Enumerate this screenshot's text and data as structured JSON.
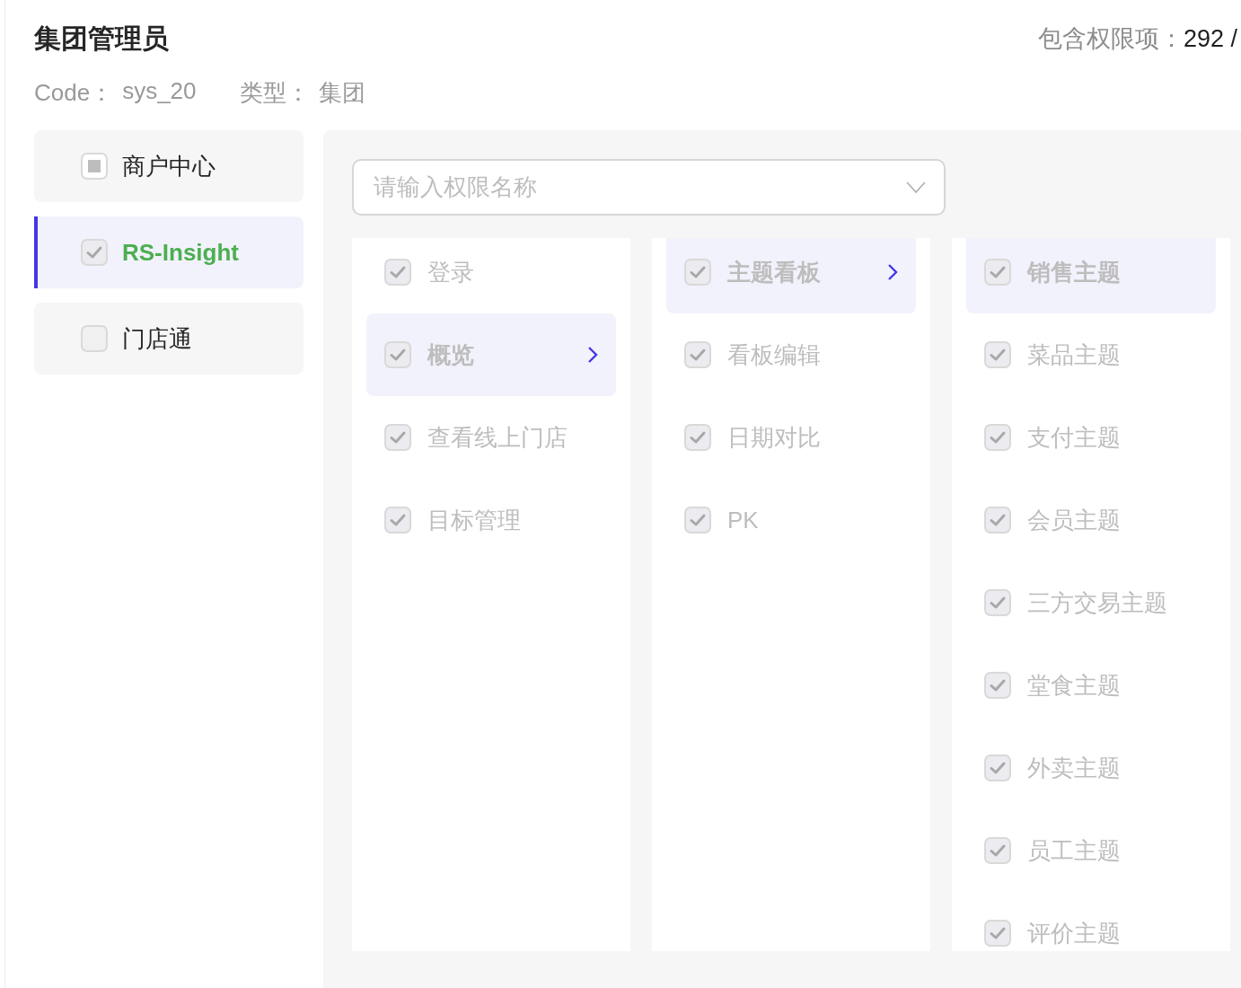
{
  "header": {
    "title": "集团管理员",
    "count_label": "包含权限项：",
    "count_value": "292 /",
    "code_label": "Code：",
    "code_value": "sys_20",
    "type_label": "类型：",
    "type_value": "集团"
  },
  "apps": [
    {
      "label": "商户中心",
      "checked": false,
      "partial": true,
      "selected": false
    },
    {
      "label": "RS-Insight",
      "checked": true,
      "partial": false,
      "selected": true
    },
    {
      "label": "门店通",
      "checked": false,
      "partial": false,
      "selected": false
    }
  ],
  "search": {
    "placeholder": "请输入权限名称"
  },
  "columns": [
    {
      "items": [
        {
          "label": "登录",
          "checked": true,
          "selected": false,
          "expandable": false
        },
        {
          "label": "概览",
          "checked": true,
          "selected": true,
          "expandable": true
        },
        {
          "label": "查看线上门店",
          "checked": true,
          "selected": false,
          "expandable": false
        },
        {
          "label": "目标管理",
          "checked": true,
          "selected": false,
          "expandable": false
        }
      ]
    },
    {
      "items": [
        {
          "label": "主题看板",
          "checked": true,
          "selected": true,
          "expandable": true
        },
        {
          "label": "看板编辑",
          "checked": true,
          "selected": false,
          "expandable": false
        },
        {
          "label": "日期对比",
          "checked": true,
          "selected": false,
          "expandable": false
        },
        {
          "label": "PK",
          "checked": true,
          "selected": false,
          "expandable": false
        }
      ]
    },
    {
      "items": [
        {
          "label": "销售主题",
          "checked": true,
          "selected": true,
          "expandable": false
        },
        {
          "label": "菜品主题",
          "checked": true,
          "selected": false,
          "expandable": false
        },
        {
          "label": "支付主题",
          "checked": true,
          "selected": false,
          "expandable": false
        },
        {
          "label": "会员主题",
          "checked": true,
          "selected": false,
          "expandable": false
        },
        {
          "label": "三方交易主题",
          "checked": true,
          "selected": false,
          "expandable": false
        },
        {
          "label": "堂食主题",
          "checked": true,
          "selected": false,
          "expandable": false
        },
        {
          "label": "外卖主题",
          "checked": true,
          "selected": false,
          "expandable": false
        },
        {
          "label": "员工主题",
          "checked": true,
          "selected": false,
          "expandable": false
        },
        {
          "label": "评价主题",
          "checked": true,
          "selected": false,
          "expandable": false
        }
      ]
    }
  ]
}
